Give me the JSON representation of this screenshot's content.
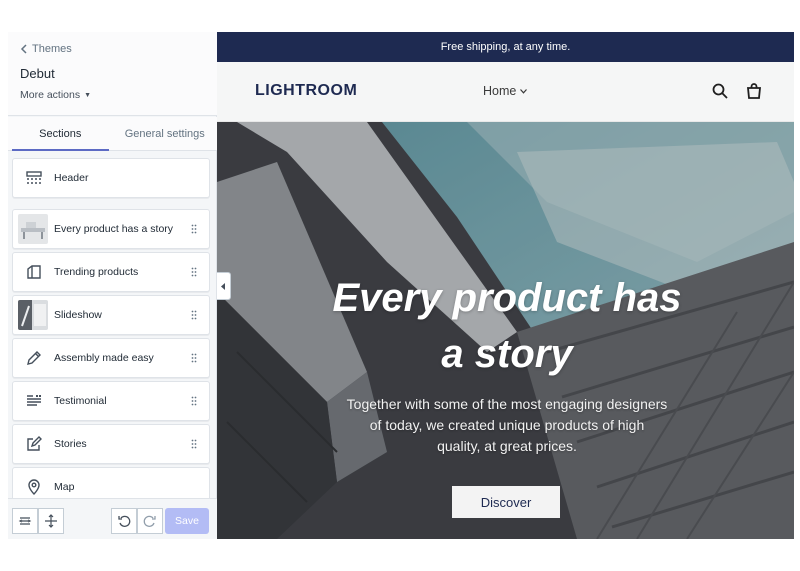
{
  "sidebar": {
    "back_label": "Themes",
    "theme_name": "Debut",
    "more_actions": "More actions",
    "tabs": [
      {
        "label": "Sections",
        "active": true
      },
      {
        "label": "General settings",
        "active": false
      }
    ],
    "sections": [
      {
        "label": "Header",
        "icon": "header-layout-icon"
      },
      {
        "label": "Every product has a story",
        "icon": "image-thumbnail"
      },
      {
        "label": "Trending products",
        "icon": "product-collection-icon"
      },
      {
        "label": "Slideshow",
        "icon": "slideshow-thumbnail"
      },
      {
        "label": "Assembly made easy",
        "icon": "pencil-icon"
      },
      {
        "label": "Testimonial",
        "icon": "text-lines-icon"
      },
      {
        "label": "Stories",
        "icon": "edit-note-icon"
      },
      {
        "label": "Map",
        "icon": "map-pin-icon"
      }
    ],
    "save_label": "Save"
  },
  "preview": {
    "announcement": "Free shipping, at any time.",
    "logo": "LIGHTROOM",
    "nav_home": "Home",
    "hero_title": "Every product has\na story",
    "hero_subtitle": "Together with some of the most engaging designers\nof today, we created unique products of high\nquality, at great prices.",
    "hero_button": "Discover"
  },
  "colors": {
    "announcement_bg": "#1e2a51",
    "accent": "#5c6ac4",
    "save_disabled": "#b3bcf5"
  }
}
